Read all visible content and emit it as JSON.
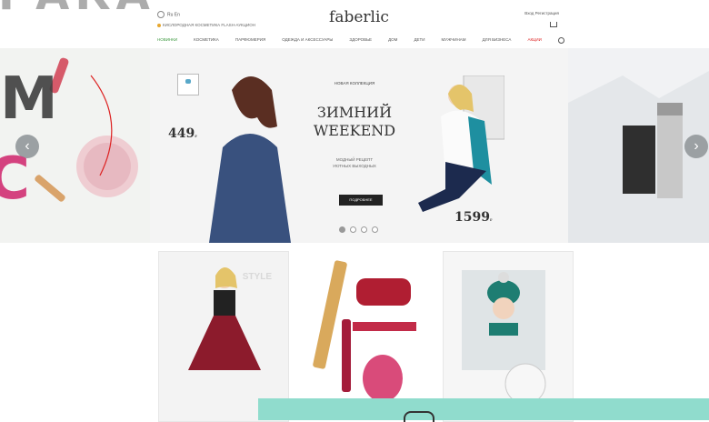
{
  "header": {
    "logo": "faberlic",
    "lang": "Ru En",
    "promo": "КИСЛОРОДНАЯ КОСМЕТИКА FLASH-АУКЦИОН",
    "user": "Вход Регистрация"
  },
  "nav": [
    "НОВИНКИ",
    "КОСМЕТИКА",
    "ПАРФЮМЕРИЯ",
    "ОДЕЖДА И АКСЕССУАРЫ",
    "ЗДОРОВЬЕ",
    "ДОМ",
    "ДЕТИ",
    "МУЖЧИНАМ",
    "ДЛЯ БИЗНЕСА",
    "АКЦИИ"
  ],
  "banner": {
    "collection": "НОВАЯ КОЛЛЕКЦИЯ",
    "title1": "ЗИМНИЙ",
    "title2": "WEEKEND",
    "desc1": "МОДНЫЙ РЕЦЕПТ",
    "desc2": "УЮТНЫХ ВЫХОДНЫХ",
    "button": "ПОДРОБНЕЕ",
    "price_left": "449",
    "price_right": "1599"
  },
  "cards": {
    "style": "STYLE"
  },
  "background_text": {
    "top": "РАКА",
    "m": "М",
    "c": "С"
  }
}
